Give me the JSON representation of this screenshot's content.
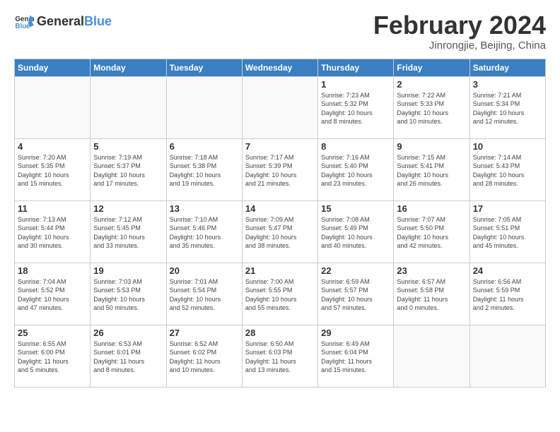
{
  "logo": {
    "text_general": "General",
    "text_blue": "Blue"
  },
  "title": {
    "month_year": "February 2024",
    "location": "Jinrongjie, Beijing, China"
  },
  "days_of_week": [
    "Sunday",
    "Monday",
    "Tuesday",
    "Wednesday",
    "Thursday",
    "Friday",
    "Saturday"
  ],
  "weeks": [
    [
      {
        "day": "",
        "info": ""
      },
      {
        "day": "",
        "info": ""
      },
      {
        "day": "",
        "info": ""
      },
      {
        "day": "",
        "info": ""
      },
      {
        "day": "1",
        "info": "Sunrise: 7:23 AM\nSunset: 5:32 PM\nDaylight: 10 hours\nand 8 minutes."
      },
      {
        "day": "2",
        "info": "Sunrise: 7:22 AM\nSunset: 5:33 PM\nDaylight: 10 hours\nand 10 minutes."
      },
      {
        "day": "3",
        "info": "Sunrise: 7:21 AM\nSunset: 5:34 PM\nDaylight: 10 hours\nand 12 minutes."
      }
    ],
    [
      {
        "day": "4",
        "info": "Sunrise: 7:20 AM\nSunset: 5:35 PM\nDaylight: 10 hours\nand 15 minutes."
      },
      {
        "day": "5",
        "info": "Sunrise: 7:19 AM\nSunset: 5:37 PM\nDaylight: 10 hours\nand 17 minutes."
      },
      {
        "day": "6",
        "info": "Sunrise: 7:18 AM\nSunset: 5:38 PM\nDaylight: 10 hours\nand 19 minutes."
      },
      {
        "day": "7",
        "info": "Sunrise: 7:17 AM\nSunset: 5:39 PM\nDaylight: 10 hours\nand 21 minutes."
      },
      {
        "day": "8",
        "info": "Sunrise: 7:16 AM\nSunset: 5:40 PM\nDaylight: 10 hours\nand 23 minutes."
      },
      {
        "day": "9",
        "info": "Sunrise: 7:15 AM\nSunset: 5:41 PM\nDaylight: 10 hours\nand 26 minutes."
      },
      {
        "day": "10",
        "info": "Sunrise: 7:14 AM\nSunset: 5:43 PM\nDaylight: 10 hours\nand 28 minutes."
      }
    ],
    [
      {
        "day": "11",
        "info": "Sunrise: 7:13 AM\nSunset: 5:44 PM\nDaylight: 10 hours\nand 30 minutes."
      },
      {
        "day": "12",
        "info": "Sunrise: 7:12 AM\nSunset: 5:45 PM\nDaylight: 10 hours\nand 33 minutes."
      },
      {
        "day": "13",
        "info": "Sunrise: 7:10 AM\nSunset: 5:46 PM\nDaylight: 10 hours\nand 35 minutes."
      },
      {
        "day": "14",
        "info": "Sunrise: 7:09 AM\nSunset: 5:47 PM\nDaylight: 10 hours\nand 38 minutes."
      },
      {
        "day": "15",
        "info": "Sunrise: 7:08 AM\nSunset: 5:49 PM\nDaylight: 10 hours\nand 40 minutes."
      },
      {
        "day": "16",
        "info": "Sunrise: 7:07 AM\nSunset: 5:50 PM\nDaylight: 10 hours\nand 42 minutes."
      },
      {
        "day": "17",
        "info": "Sunrise: 7:05 AM\nSunset: 5:51 PM\nDaylight: 10 hours\nand 45 minutes."
      }
    ],
    [
      {
        "day": "18",
        "info": "Sunrise: 7:04 AM\nSunset: 5:52 PM\nDaylight: 10 hours\nand 47 minutes."
      },
      {
        "day": "19",
        "info": "Sunrise: 7:03 AM\nSunset: 5:53 PM\nDaylight: 10 hours\nand 50 minutes."
      },
      {
        "day": "20",
        "info": "Sunrise: 7:01 AM\nSunset: 5:54 PM\nDaylight: 10 hours\nand 52 minutes."
      },
      {
        "day": "21",
        "info": "Sunrise: 7:00 AM\nSunset: 5:55 PM\nDaylight: 10 hours\nand 55 minutes."
      },
      {
        "day": "22",
        "info": "Sunrise: 6:59 AM\nSunset: 5:57 PM\nDaylight: 10 hours\nand 57 minutes."
      },
      {
        "day": "23",
        "info": "Sunrise: 6:57 AM\nSunset: 5:58 PM\nDaylight: 11 hours\nand 0 minutes."
      },
      {
        "day": "24",
        "info": "Sunrise: 6:56 AM\nSunset: 5:59 PM\nDaylight: 11 hours\nand 2 minutes."
      }
    ],
    [
      {
        "day": "25",
        "info": "Sunrise: 6:55 AM\nSunset: 6:00 PM\nDaylight: 11 hours\nand 5 minutes."
      },
      {
        "day": "26",
        "info": "Sunrise: 6:53 AM\nSunset: 6:01 PM\nDaylight: 11 hours\nand 8 minutes."
      },
      {
        "day": "27",
        "info": "Sunrise: 6:52 AM\nSunset: 6:02 PM\nDaylight: 11 hours\nand 10 minutes."
      },
      {
        "day": "28",
        "info": "Sunrise: 6:50 AM\nSunset: 6:03 PM\nDaylight: 11 hours\nand 13 minutes."
      },
      {
        "day": "29",
        "info": "Sunrise: 6:49 AM\nSunset: 6:04 PM\nDaylight: 11 hours\nand 15 minutes."
      },
      {
        "day": "",
        "info": ""
      },
      {
        "day": "",
        "info": ""
      }
    ]
  ]
}
